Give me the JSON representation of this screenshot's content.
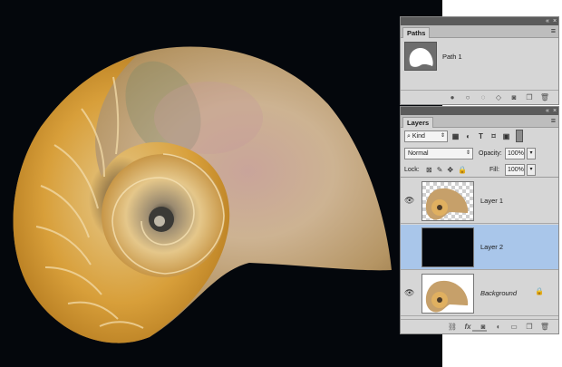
{
  "paths_panel": {
    "tab_label": "Paths",
    "controls": "«",
    "close": "×",
    "menu_icon": "panel-menu-icon",
    "path_name": "Path 1",
    "tools": [
      "fill-path-icon",
      "stroke-path-icon",
      "load-selection-icon",
      "make-path-icon",
      "add-mask-icon",
      "new-path-icon",
      "delete-path-icon"
    ]
  },
  "layers_panel": {
    "tab_label": "Layers",
    "controls": "«",
    "close": "×",
    "filter_kind": "Kind",
    "filter_prefix": "⌕",
    "blend_mode": "Normal",
    "opacity_label": "Opacity:",
    "opacity_value": "100%",
    "lock_label": "Lock:",
    "fill_label": "Fill:",
    "fill_value": "100%",
    "layers": [
      {
        "name": "Layer 1",
        "visible": true,
        "selected": false,
        "locked": false,
        "italic": false
      },
      {
        "name": "Layer 2",
        "visible": false,
        "selected": true,
        "locked": false,
        "italic": false
      },
      {
        "name": "Background",
        "visible": true,
        "selected": false,
        "locked": true,
        "italic": true
      }
    ],
    "tools": [
      "link-layers-icon",
      "fx-icon",
      "add-mask-icon",
      "adjustment-layer-icon",
      "new-group-icon",
      "new-layer-icon",
      "delete-layer-icon"
    ],
    "fx_label": "fx"
  },
  "colors": {
    "canvas_bg": "#04070c",
    "panel_bg": "#d6d6d6",
    "selected_row": "#a9c6ea"
  }
}
